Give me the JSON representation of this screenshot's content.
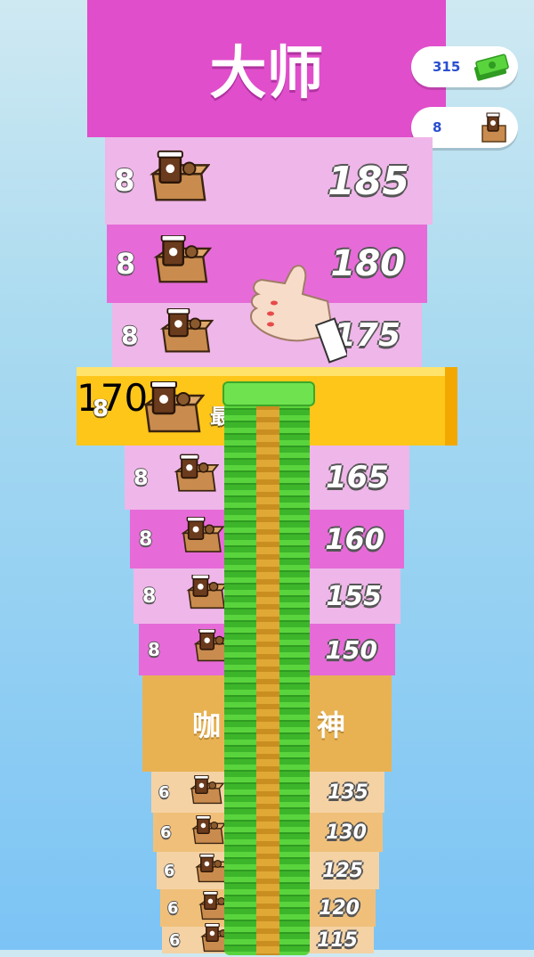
{
  "tier_top": {
    "title": "大师"
  },
  "tier_mid": {
    "title_left": "咖",
    "title_right": "神"
  },
  "currency": {
    "cash": "315",
    "boxes": "8"
  },
  "best_record": {
    "count": "8",
    "label": "最好记录",
    "value": "170"
  },
  "upper_rows": [
    {
      "count": "8",
      "value": "185"
    },
    {
      "count": "8",
      "value": "180"
    },
    {
      "count": "8",
      "value": "175"
    },
    {
      "count": "8",
      "value": "165"
    },
    {
      "count": "8",
      "value": "160"
    },
    {
      "count": "8",
      "value": "155"
    },
    {
      "count": "8",
      "value": "150"
    }
  ],
  "lower_rows": [
    {
      "count": "6",
      "value": "135"
    },
    {
      "count": "6",
      "value": "130"
    },
    {
      "count": "6",
      "value": "125"
    },
    {
      "count": "6",
      "value": "120"
    },
    {
      "count": "6",
      "value": "115"
    }
  ],
  "icons": {
    "cash": "cash-stack-icon",
    "box": "coffee-box-icon",
    "hand": "thumbs-up-hand"
  }
}
